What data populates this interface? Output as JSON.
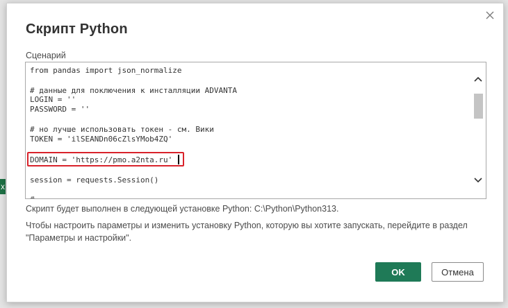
{
  "background": {
    "edge_glyph": "x",
    "accent": "#1e7145"
  },
  "dialog": {
    "title": "Скрипт Python",
    "close_icon": "close-icon",
    "script_label": "Сценарий",
    "code_lines": [
      "from pandas import json_normalize",
      "",
      "# данные для поключения к инсталляции ADVANTA",
      "LOGIN = ''",
      "PASSWORD = ''",
      "",
      "# но лучше использовать токен - см. Вики",
      "TOKEN = 'ilSEANDn06cZlsYMob4ZQ'",
      "",
      "DOMAIN = 'https://pmo.a2nta.ru'",
      "",
      "session = requests.Session()",
      "",
      "# ..."
    ],
    "info_line_1": "Скрипт будет выполнен в следующей установке Python: C:\\Python\\Python313.",
    "info_line_2": "Чтобы настроить параметры и изменить установку Python, которую вы хотите запускать, перейдите в раздел",
    "info_line_3": "\"Параметры и настройки\".",
    "ok_label": "OK",
    "cancel_label": "Отмена",
    "colors": {
      "ok_button": "#1f7a57",
      "highlight_border": "#d9222a"
    }
  }
}
